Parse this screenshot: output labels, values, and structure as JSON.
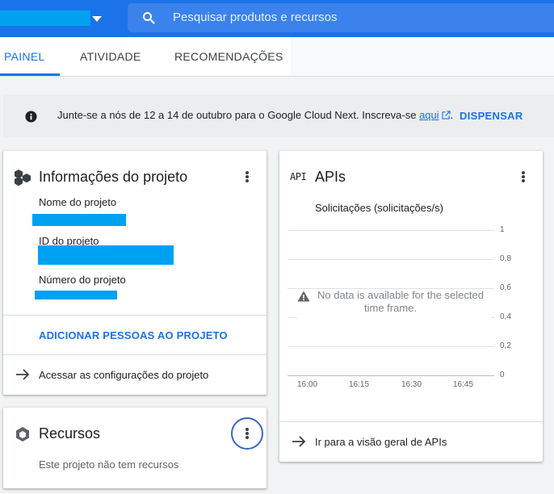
{
  "header": {
    "search_placeholder": "Pesquisar produtos e recursos"
  },
  "tabs": [
    {
      "label": "PAINEL",
      "active": true
    },
    {
      "label": "ATIVIDADE",
      "active": false
    },
    {
      "label": "RECOMENDAÇÕES",
      "active": false
    }
  ],
  "banner": {
    "text": "Junte-se a nós de 12 a 14 de outubro para o Google Cloud Next. Inscreva-se ",
    "link": "aqui",
    "suffix": ".",
    "dismiss": "DISPENSAR"
  },
  "project_info": {
    "title": "Informações do projeto",
    "name_label": "Nome do projeto",
    "id_label": "ID do projeto",
    "number_label": "Número do projeto",
    "add_people": "ADICIONAR PESSOAS AO PROJETO",
    "settings_link": "Acessar as configurações do projeto"
  },
  "resources": {
    "title": "Recursos",
    "empty": "Este projeto não tem recursos"
  },
  "apis": {
    "icon_text": "API",
    "title": "APIs",
    "chart_title": "Solicitações (solicitações/s)",
    "no_data_line1": "No data is available for the selected",
    "no_data_line2": "time frame.",
    "overview_link": "Ir para a visão geral de APIs"
  },
  "chart_data": {
    "type": "line",
    "title": "Solicitações (solicitações/s)",
    "x_ticks": [
      "16:00",
      "16:15",
      "16:30",
      "16:45"
    ],
    "y_ticks": [
      "1",
      "0,8",
      "0,6",
      "0,4",
      "0,2",
      "0"
    ],
    "ylim": [
      0,
      1
    ],
    "series": [],
    "annotation": "No data is available for the selected time frame."
  },
  "colors": {
    "brand_blue": "#1a73e8",
    "redaction": "#00a1f1"
  }
}
